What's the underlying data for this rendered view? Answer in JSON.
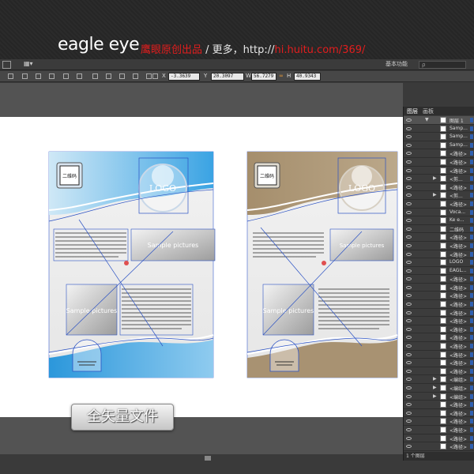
{
  "banner": {
    "brand": "eagle eye",
    "tagline_red1": "鹰眼原创出品",
    "tagline_mid": " / 更多，http://",
    "tagline_red2": "hi.huitu.com/369/"
  },
  "menubar": {
    "workspace_label": "基本功能",
    "search_placeholder": "ρ"
  },
  "control": {
    "x": "-3.3639",
    "y": "20.3097",
    "w": "56.7279",
    "h": "40.9343"
  },
  "templates": {
    "logo": "LOGO",
    "qr_label": "二维码",
    "picture_label": "Sample pictures"
  },
  "panel": {
    "tabs": [
      "图层",
      "画板"
    ],
    "footer": "1 个图层",
    "layers": [
      {
        "name": "图层 1",
        "expanded": true,
        "selected": true
      },
      {
        "name": "Samp..."
      },
      {
        "name": "Samp..."
      },
      {
        "name": "Samp..."
      },
      {
        "name": "<路径>"
      },
      {
        "name": "<路径>"
      },
      {
        "name": "<路径>"
      },
      {
        "name": "<剪...",
        "expander": true
      },
      {
        "name": "<路径>"
      },
      {
        "name": "<剪...",
        "expander": true
      },
      {
        "name": "<路径>"
      },
      {
        "name": "Voca..."
      },
      {
        "name": "Ke e..."
      },
      {
        "name": "二维码"
      },
      {
        "name": "<路径>"
      },
      {
        "name": "<路径>"
      },
      {
        "name": "<路径>"
      },
      {
        "name": "LOGO"
      },
      {
        "name": "EAGL..."
      },
      {
        "name": "<路径>"
      },
      {
        "name": "<路径>"
      },
      {
        "name": "<路径>"
      },
      {
        "name": "<路径>"
      },
      {
        "name": "<路径>"
      },
      {
        "name": "<路径>"
      },
      {
        "name": "<路径>"
      },
      {
        "name": "<路径>"
      },
      {
        "name": "<路径>"
      },
      {
        "name": "<路径>"
      },
      {
        "name": "<路径>"
      },
      {
        "name": "<路径>"
      },
      {
        "name": "<编组>",
        "expander": true
      },
      {
        "name": "<编组>",
        "expander": true
      },
      {
        "name": "<编组>",
        "expander": true
      },
      {
        "name": "<路径>"
      },
      {
        "name": "<路径>"
      },
      {
        "name": "<路径>"
      },
      {
        "name": "<路径>"
      },
      {
        "name": "<路径>"
      },
      {
        "name": "<路径>"
      },
      {
        "name": "<路径>"
      }
    ]
  },
  "overlay": {
    "badge": "全矢量文件"
  },
  "colors": {
    "blue_theme": "#3aa3e3",
    "brown_theme": "#a89272",
    "selection": "#2b52c4"
  }
}
